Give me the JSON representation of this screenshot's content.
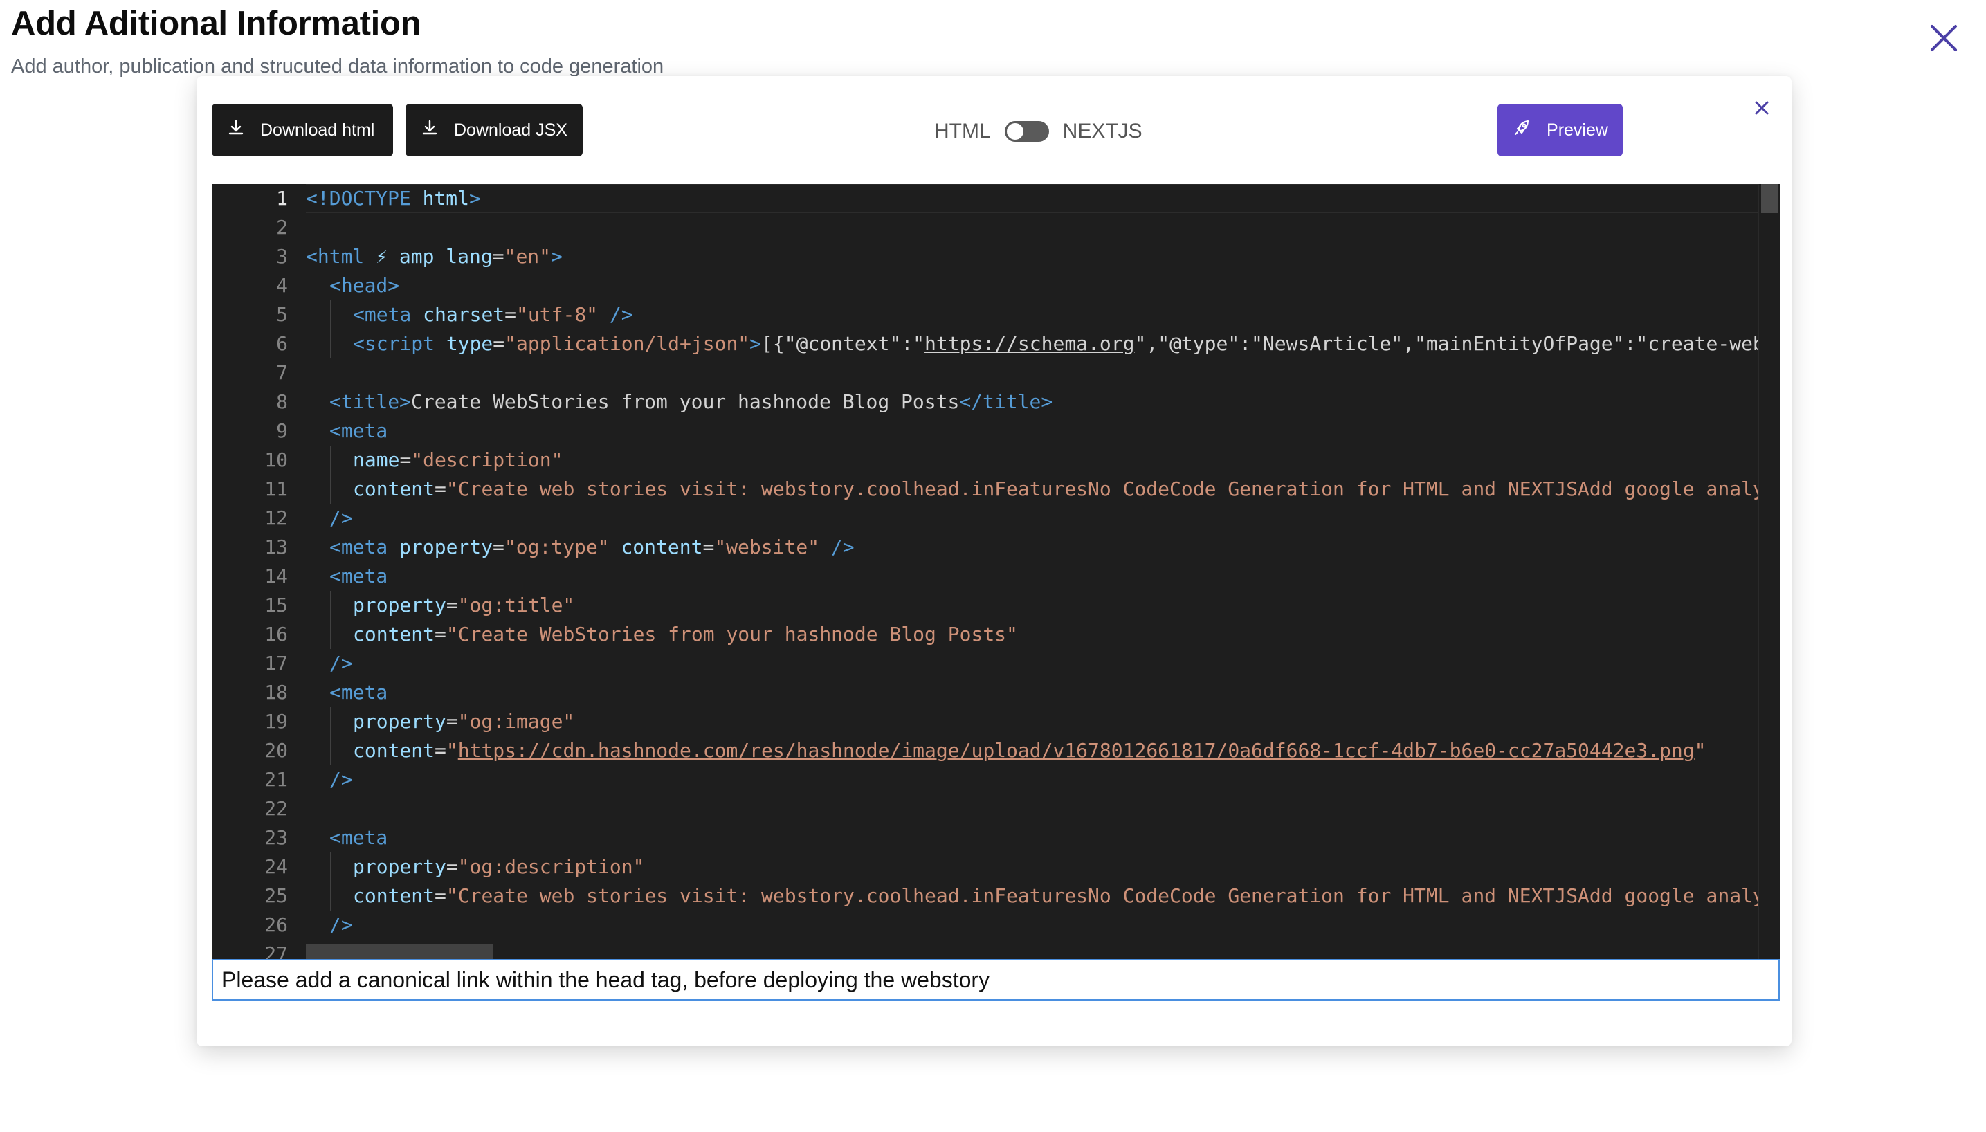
{
  "header": {
    "title": "Add Aditional Information",
    "subtitle": "Add author, publication and strucuted data information to code generation"
  },
  "toolbar": {
    "download_html_label": "Download html",
    "download_jsx_label": "Download JSX",
    "toggle_left_label": "HTML",
    "toggle_right_label": "NEXTJS",
    "toggle_state": "HTML",
    "preview_label": "Preview"
  },
  "icons": {
    "page_close": "close-icon",
    "modal_close": "close-icon",
    "download": "download-icon",
    "preview": "rocket-icon"
  },
  "colors": {
    "preview_button": "#6147c9",
    "dark_button": "#1c1c1c",
    "editor_background": "#1e1e1e",
    "tag": "#569cd6",
    "attribute": "#9cdcfe",
    "string": "#ce9178",
    "input_border": "#4a8fe0",
    "close_icon": "#4b3fa6"
  },
  "editor": {
    "active_line": 1,
    "lines": [
      {
        "n": "1",
        "indent": 0,
        "tokens": [
          {
            "t": "tag",
            "v": "<!DOCTYPE "
          },
          {
            "t": "attr",
            "v": "html"
          },
          {
            "t": "tag",
            "v": ">"
          }
        ]
      },
      {
        "n": "2",
        "indent": 0,
        "tokens": []
      },
      {
        "n": "3",
        "indent": 0,
        "tokens": [
          {
            "t": "tag",
            "v": "<html "
          },
          {
            "t": "attr",
            "v": "⚡ amp lang"
          },
          {
            "t": "txt",
            "v": "="
          },
          {
            "t": "str",
            "v": "\"en\""
          },
          {
            "t": "tag",
            "v": ">"
          }
        ]
      },
      {
        "n": "4",
        "indent": 1,
        "tokens": [
          {
            "t": "tag",
            "v": "<head>"
          }
        ]
      },
      {
        "n": "5",
        "indent": 2,
        "tokens": [
          {
            "t": "tag",
            "v": "<meta "
          },
          {
            "t": "attr",
            "v": "charset"
          },
          {
            "t": "txt",
            "v": "="
          },
          {
            "t": "str",
            "v": "\"utf-8\""
          },
          {
            "t": "tag",
            "v": " />"
          }
        ]
      },
      {
        "n": "6",
        "indent": 2,
        "tokens": [
          {
            "t": "tag",
            "v": "<script "
          },
          {
            "t": "attr",
            "v": "type"
          },
          {
            "t": "txt",
            "v": "="
          },
          {
            "t": "str",
            "v": "\"application/ld+json\""
          },
          {
            "t": "tag",
            "v": ">"
          },
          {
            "t": "txt",
            "v": "[{\"@context\":\""
          },
          {
            "t": "url",
            "v": "https://schema.org"
          },
          {
            "t": "txt",
            "v": "\",\"@type\":\"NewsArticle\",\"mainEntityOfPage\":\"create-webs"
          }
        ]
      },
      {
        "n": "7",
        "indent": 0,
        "tokens": []
      },
      {
        "n": "8",
        "indent": 1,
        "tokens": [
          {
            "t": "tag",
            "v": "<title>"
          },
          {
            "t": "txt",
            "v": "Create WebStories from your hashnode Blog Posts"
          },
          {
            "t": "tag",
            "v": "</title>"
          }
        ]
      },
      {
        "n": "9",
        "indent": 1,
        "tokens": [
          {
            "t": "tag",
            "v": "<meta"
          }
        ]
      },
      {
        "n": "10",
        "indent": 2,
        "tokens": [
          {
            "t": "attr",
            "v": "name"
          },
          {
            "t": "txt",
            "v": "="
          },
          {
            "t": "str",
            "v": "\"description\""
          }
        ]
      },
      {
        "n": "11",
        "indent": 2,
        "tokens": [
          {
            "t": "attr",
            "v": "content"
          },
          {
            "t": "txt",
            "v": "="
          },
          {
            "t": "str",
            "v": "\"Create web stories visit: webstory.coolhead.inFeaturesNo CodeCode Generation for HTML and NEXTJSAdd google analyt"
          }
        ]
      },
      {
        "n": "12",
        "indent": 1,
        "tokens": [
          {
            "t": "tag",
            "v": "/>"
          }
        ]
      },
      {
        "n": "13",
        "indent": 1,
        "tokens": [
          {
            "t": "tag",
            "v": "<meta "
          },
          {
            "t": "attr",
            "v": "property"
          },
          {
            "t": "txt",
            "v": "="
          },
          {
            "t": "str",
            "v": "\"og:type\""
          },
          {
            "t": "txt",
            "v": " "
          },
          {
            "t": "attr",
            "v": "content"
          },
          {
            "t": "txt",
            "v": "="
          },
          {
            "t": "str",
            "v": "\"website\""
          },
          {
            "t": "tag",
            "v": " />"
          }
        ]
      },
      {
        "n": "14",
        "indent": 1,
        "tokens": [
          {
            "t": "tag",
            "v": "<meta"
          }
        ]
      },
      {
        "n": "15",
        "indent": 2,
        "tokens": [
          {
            "t": "attr",
            "v": "property"
          },
          {
            "t": "txt",
            "v": "="
          },
          {
            "t": "str",
            "v": "\"og:title\""
          }
        ]
      },
      {
        "n": "16",
        "indent": 2,
        "tokens": [
          {
            "t": "attr",
            "v": "content"
          },
          {
            "t": "txt",
            "v": "="
          },
          {
            "t": "str",
            "v": "\"Create WebStories from your hashnode Blog Posts\""
          }
        ]
      },
      {
        "n": "17",
        "indent": 1,
        "tokens": [
          {
            "t": "tag",
            "v": "/>"
          }
        ]
      },
      {
        "n": "18",
        "indent": 1,
        "tokens": [
          {
            "t": "tag",
            "v": "<meta"
          }
        ]
      },
      {
        "n": "19",
        "indent": 2,
        "tokens": [
          {
            "t": "attr",
            "v": "property"
          },
          {
            "t": "txt",
            "v": "="
          },
          {
            "t": "str",
            "v": "\"og:image\""
          }
        ]
      },
      {
        "n": "20",
        "indent": 2,
        "tokens": [
          {
            "t": "attr",
            "v": "content"
          },
          {
            "t": "txt",
            "v": "="
          },
          {
            "t": "str",
            "v": "\""
          },
          {
            "t": "strurl",
            "v": "https://cdn.hashnode.com/res/hashnode/image/upload/v1678012661817/0a6df668-1ccf-4db7-b6e0-cc27a50442e3.png"
          },
          {
            "t": "str",
            "v": "\""
          }
        ]
      },
      {
        "n": "21",
        "indent": 1,
        "tokens": [
          {
            "t": "tag",
            "v": "/>"
          }
        ]
      },
      {
        "n": "22",
        "indent": 0,
        "tokens": []
      },
      {
        "n": "23",
        "indent": 1,
        "tokens": [
          {
            "t": "tag",
            "v": "<meta"
          }
        ]
      },
      {
        "n": "24",
        "indent": 2,
        "tokens": [
          {
            "t": "attr",
            "v": "property"
          },
          {
            "t": "txt",
            "v": "="
          },
          {
            "t": "str",
            "v": "\"og:description\""
          }
        ]
      },
      {
        "n": "25",
        "indent": 2,
        "tokens": [
          {
            "t": "attr",
            "v": "content"
          },
          {
            "t": "txt",
            "v": "="
          },
          {
            "t": "str",
            "v": "\"Create web stories visit: webstory.coolhead.inFeaturesNo CodeCode Generation for HTML and NEXTJSAdd google analyt"
          }
        ]
      },
      {
        "n": "26",
        "indent": 1,
        "tokens": [
          {
            "t": "tag",
            "v": "/>"
          }
        ]
      },
      {
        "n": "27",
        "indent": 0,
        "tokens": []
      }
    ]
  },
  "canonical_note": {
    "value": "Please add a canonical link within the head tag, before deploying the webstory",
    "placeholder": ""
  }
}
